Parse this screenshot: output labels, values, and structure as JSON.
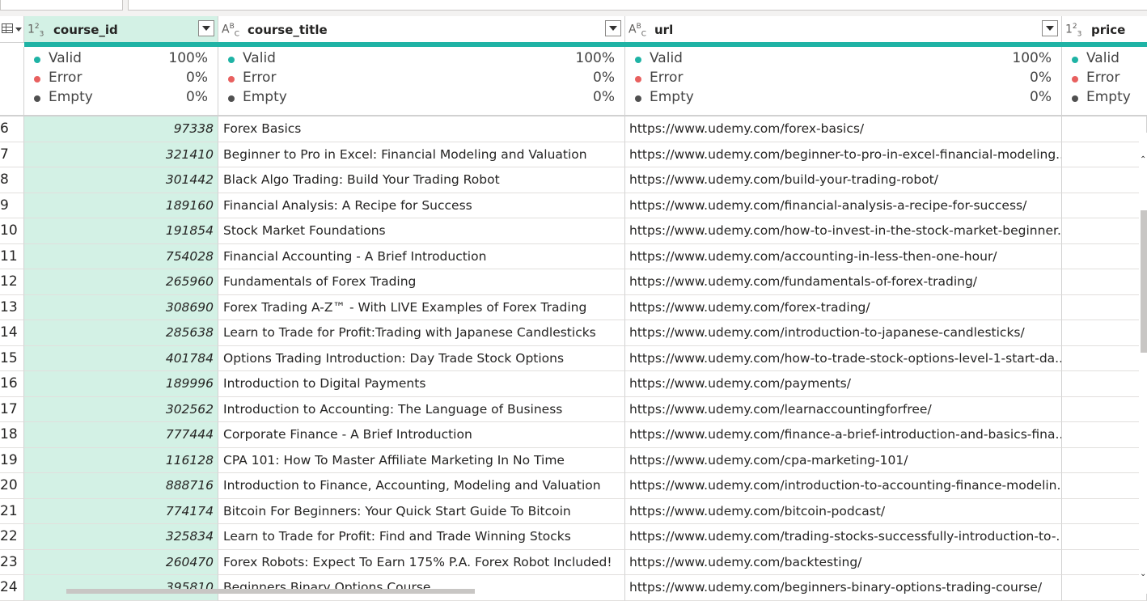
{
  "columns": [
    {
      "type_icon": "1²₃",
      "name": "course_id"
    },
    {
      "type_icon": "A^B_C",
      "name": "course_title"
    },
    {
      "type_icon": "A^B_C",
      "name": "url"
    },
    {
      "type_icon": "1²₃",
      "name": "price"
    }
  ],
  "quality": {
    "valid_label": "Valid",
    "error_label": "Error",
    "empty_label": "Empty",
    "course_id": {
      "valid": "100%",
      "error": "0%",
      "empty": "0%"
    },
    "course_title": {
      "valid": "100%",
      "error": "0%",
      "empty": "0%"
    },
    "url": {
      "valid": "100%",
      "error": "0%",
      "empty": "0%"
    }
  },
  "colors": {
    "valid": "#1fb3a5",
    "error": "#e8605f",
    "empty": "#505050",
    "selected_column": "#d3f1e5"
  },
  "rows": [
    {
      "n": "6",
      "id": "97338",
      "title": "Forex Basics",
      "url": "https://www.udemy.com/forex-basics/"
    },
    {
      "n": "7",
      "id": "321410",
      "title": "Beginner to Pro in Excel: Financial Modeling and Valuation",
      "url": "https://www.udemy.com/beginner-to-pro-in-excel-financial-modeling..."
    },
    {
      "n": "8",
      "id": "301442",
      "title": "Black Algo Trading: Build Your Trading Robot",
      "url": "https://www.udemy.com/build-your-trading-robot/"
    },
    {
      "n": "9",
      "id": "189160",
      "title": "Financial Analysis: A Recipe for Success",
      "url": "https://www.udemy.com/financial-analysis-a-recipe-for-success/"
    },
    {
      "n": "10",
      "id": "191854",
      "title": "Stock Market Foundations",
      "url": "https://www.udemy.com/how-to-invest-in-the-stock-market-beginner..."
    },
    {
      "n": "11",
      "id": "754028",
      "title": "Financial Accounting - A Brief Introduction",
      "url": "https://www.udemy.com/accounting-in-less-then-one-hour/"
    },
    {
      "n": "12",
      "id": "265960",
      "title": "Fundamentals of Forex Trading",
      "url": "https://www.udemy.com/fundamentals-of-forex-trading/"
    },
    {
      "n": "13",
      "id": "308690",
      "title": "Forex Trading A-Z™ - With LIVE Examples of Forex Trading",
      "url": "https://www.udemy.com/forex-trading/"
    },
    {
      "n": "14",
      "id": "285638",
      "title": "Learn to Trade for Profit:Trading with Japanese Candlesticks",
      "url": "https://www.udemy.com/introduction-to-japanese-candlesticks/"
    },
    {
      "n": "15",
      "id": "401784",
      "title": "Options Trading Introduction: Day Trade Stock Options",
      "url": "https://www.udemy.com/how-to-trade-stock-options-level-1-start-da..."
    },
    {
      "n": "16",
      "id": "189996",
      "title": "Introduction to Digital Payments",
      "url": "https://www.udemy.com/payments/"
    },
    {
      "n": "17",
      "id": "302562",
      "title": "Introduction to Accounting: The Language of Business",
      "url": "https://www.udemy.com/learnaccountingforfree/"
    },
    {
      "n": "18",
      "id": "777444",
      "title": "Corporate Finance - A Brief Introduction",
      "url": "https://www.udemy.com/finance-a-brief-introduction-and-basics-fina..."
    },
    {
      "n": "19",
      "id": "116128",
      "title": "CPA 101: How To Master Affiliate Marketing In No Time",
      "url": "https://www.udemy.com/cpa-marketing-101/"
    },
    {
      "n": "20",
      "id": "888716",
      "title": "Introduction to Finance, Accounting, Modeling and Valuation",
      "url": "https://www.udemy.com/introduction-to-accounting-finance-modelin..."
    },
    {
      "n": "21",
      "id": "774174",
      "title": "Bitcoin For Beginners: Your Quick Start Guide To Bitcoin",
      "url": "https://www.udemy.com/bitcoin-podcast/"
    },
    {
      "n": "22",
      "id": "325834",
      "title": "Learn to Trade for Profit: Find and Trade Winning Stocks",
      "url": "https://www.udemy.com/trading-stocks-successfully-introduction-to-..."
    },
    {
      "n": "23",
      "id": "260470",
      "title": "Forex Robots: Expect To Earn 175% P.A. Forex Robot Included!",
      "url": "https://www.udemy.com/backtesting/"
    },
    {
      "n": "24",
      "id": "395810",
      "title": "Beginners Binary Options Course",
      "url": "https://www.udemy.com/beginners-binary-options-trading-course/"
    }
  ]
}
